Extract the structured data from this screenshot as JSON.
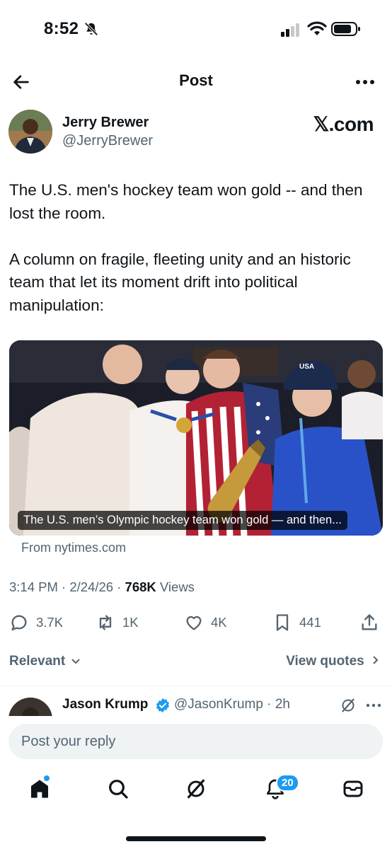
{
  "status_bar": {
    "time": "8:52"
  },
  "header": {
    "title": "Post"
  },
  "author": {
    "name": "Jerry Brewer",
    "handle": "@JerryBrewer",
    "badge_text": "𝕏.com"
  },
  "post": {
    "text": "The U.S. men's hockey team won gold -- and then lost the room.\n\nA column on fragile, fleeting unity and an historic team that let its moment drift into political manipulation:",
    "media_caption": "The U.S. men’s Olympic hockey team won gold — and then...",
    "source": "From nytimes.com",
    "time": "3:14 PM",
    "date": "2/24/26",
    "views_count": "768K",
    "views_label": "Views"
  },
  "actions": {
    "replies": "3.7K",
    "reposts": "1K",
    "likes": "4K",
    "bookmarks": "441"
  },
  "filters": {
    "sort_label": "Relevant",
    "quotes_label": "View quotes"
  },
  "reply_preview": {
    "name": "Jason Krump",
    "handle": "@JasonKrump",
    "time": "2h"
  },
  "composer": {
    "placeholder": "Post your reply"
  },
  "tabbar": {
    "notifications_badge": "20"
  },
  "colors": {
    "accent": "#1d9bf0",
    "text": "#0f1419",
    "muted": "#536471"
  }
}
